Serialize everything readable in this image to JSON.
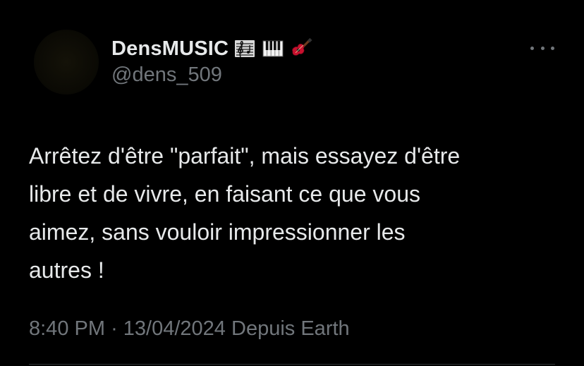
{
  "author": {
    "display_name": "DensMUSIC",
    "handle": "@dens_509",
    "name_emojis": [
      "musical-score-icon",
      "piano-keys-icon",
      "guitar-icon"
    ]
  },
  "tweet": {
    "lines": [
      "Arrêtez d'être \"parfait\", mais essayez d'être",
      "libre et de vivre, en faisant ce que vous",
      "aimez, sans vouloir impressionner les",
      "autres !"
    ]
  },
  "meta": {
    "time": "8:40 PM",
    "separator": "·",
    "date": "13/04/2024",
    "source": "Depuis Earth"
  },
  "colors": {
    "background": "#000000",
    "primary_text": "#e7e9ea",
    "secondary_text": "#71767b",
    "divider": "#2f3336"
  }
}
